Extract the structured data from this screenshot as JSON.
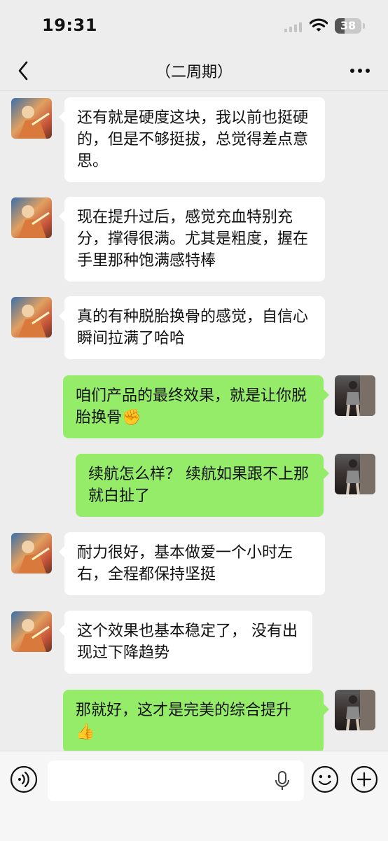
{
  "status": {
    "time": "19:31",
    "battery": "38",
    "battery_level": 0.38
  },
  "header": {
    "title": "（二周期）",
    "back_icon": "chevron-left-icon",
    "more_icon": "more-dots-icon"
  },
  "messages": [
    {
      "side": "in",
      "text": "还有就是硬度这块，我以前也挺硬的，但是不够挺拔，总觉得差点意思。"
    },
    {
      "side": "in",
      "text": "现在提升过后，感觉充血特别充分，撑得很满。尤其是粗度，握在手里那种饱满感特棒"
    },
    {
      "side": "in",
      "text": "真的有种脱胎换骨的感觉，自信心瞬间拉满了哈哈"
    },
    {
      "side": "out",
      "text": "咱们产品的最终效果，就是让你脱胎换骨",
      "emoji": "✊"
    },
    {
      "side": "out",
      "text": "续航怎么样？ 续航如果跟不上那就白扯了"
    },
    {
      "side": "in",
      "text": "耐力很好，基本做爱一个小时左右，全程都保持坚挺"
    },
    {
      "side": "in",
      "text": "这个效果也基本稳定了， 没有出现过下降趋势"
    },
    {
      "side": "out",
      "text": "那就好，这才是完美的综合提升",
      "emoji": "👍"
    }
  ],
  "input": {
    "placeholder": ""
  },
  "icons": {
    "voice": "voice-icon",
    "mic": "mic-icon",
    "emoji": "emoji-icon",
    "plus": "plus-icon"
  },
  "colors": {
    "outgoing_bubble": "#95ec69",
    "incoming_bubble": "#ffffff",
    "background": "#ededed"
  }
}
